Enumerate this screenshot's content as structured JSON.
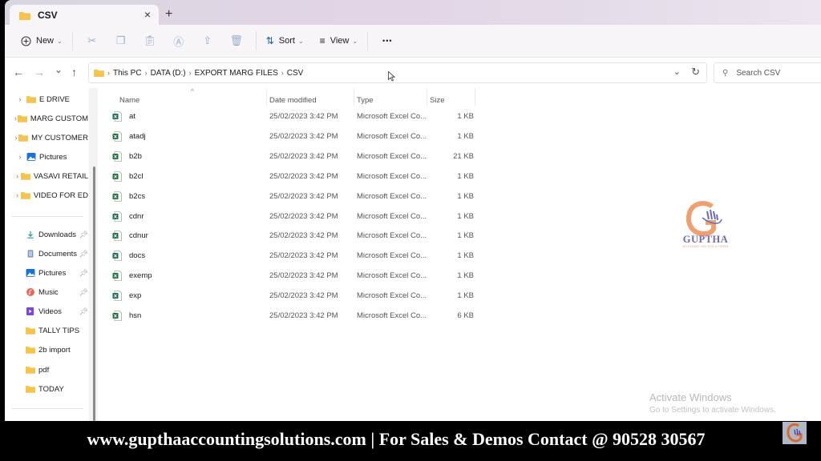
{
  "window": {
    "tab_label": "CSV",
    "tab_close_icon": "×",
    "new_tab_icon": "+"
  },
  "toolbar": {
    "new_label": "New",
    "sort_label": "Sort",
    "view_label": "View",
    "more_label": "•••",
    "icons": [
      "cut-icon",
      "copy-icon",
      "paste-icon",
      "rename-icon",
      "share-icon",
      "delete-icon"
    ]
  },
  "navigation": {
    "back": "←",
    "forward": "→",
    "recent": "⌄",
    "up": "↑",
    "breadcrumb": [
      "This PC",
      "DATA (D:)",
      "EXPORT MARG FILES",
      "CSV"
    ],
    "search_placeholder": "Search CSV"
  },
  "sidebar": {
    "tree_items": [
      {
        "label": "E DRIVE",
        "icon": "folder"
      },
      {
        "label": "MARG CUSTOM",
        "icon": "folder"
      },
      {
        "label": "MY CUSTOMER",
        "icon": "folder"
      },
      {
        "label": "Pictures",
        "icon": "pictures"
      },
      {
        "label": "VASAVI RETAIL",
        "icon": "folder"
      },
      {
        "label": "VIDEO FOR ED",
        "icon": "folder"
      }
    ],
    "quick_access": [
      {
        "label": "Downloads",
        "icon": "downloads",
        "pinned": true
      },
      {
        "label": "Documents",
        "icon": "documents",
        "pinned": true
      },
      {
        "label": "Pictures",
        "icon": "pictures",
        "pinned": true
      },
      {
        "label": "Music",
        "icon": "music",
        "pinned": true
      },
      {
        "label": "Videos",
        "icon": "videos",
        "pinned": true
      },
      {
        "label": "TALLY TIPS",
        "icon": "folder",
        "pinned": false
      },
      {
        "label": "2b import",
        "icon": "folder",
        "pinned": false
      },
      {
        "label": "pdf",
        "icon": "folder",
        "pinned": false
      },
      {
        "label": "TODAY",
        "icon": "folder",
        "pinned": false
      }
    ]
  },
  "file_list": {
    "columns": {
      "name": "Name",
      "date": "Date modified",
      "type": "Type",
      "size": "Size"
    },
    "files": [
      {
        "name": "at",
        "date": "25/02/2023 3:42 PM",
        "type": "Microsoft Excel Co...",
        "size": "1 KB"
      },
      {
        "name": "atadj",
        "date": "25/02/2023 3:42 PM",
        "type": "Microsoft Excel Co...",
        "size": "1 KB"
      },
      {
        "name": "b2b",
        "date": "25/02/2023 3:42 PM",
        "type": "Microsoft Excel Co...",
        "size": "21 KB"
      },
      {
        "name": "b2cl",
        "date": "25/02/2023 3:42 PM",
        "type": "Microsoft Excel Co...",
        "size": "1 KB"
      },
      {
        "name": "b2cs",
        "date": "25/02/2023 3:42 PM",
        "type": "Microsoft Excel Co...",
        "size": "1 KB"
      },
      {
        "name": "cdnr",
        "date": "25/02/2023 3:42 PM",
        "type": "Microsoft Excel Co...",
        "size": "1 KB"
      },
      {
        "name": "cdnur",
        "date": "25/02/2023 3:42 PM",
        "type": "Microsoft Excel Co...",
        "size": "1 KB"
      },
      {
        "name": "docs",
        "date": "25/02/2023 3:42 PM",
        "type": "Microsoft Excel Co...",
        "size": "1 KB"
      },
      {
        "name": "exemp",
        "date": "25/02/2023 3:42 PM",
        "type": "Microsoft Excel Co...",
        "size": "1 KB"
      },
      {
        "name": "exp",
        "date": "25/02/2023 3:42 PM",
        "type": "Microsoft Excel Co...",
        "size": "1 KB"
      },
      {
        "name": "hsn",
        "date": "25/02/2023 3:42 PM",
        "type": "Microsoft Excel Co...",
        "size": "6 KB"
      }
    ]
  },
  "watermark": {
    "logo_name": "GUPTHA",
    "logo_sub": "ACCOUNTING SOLUTIONS",
    "activate_title": "Activate Windows",
    "activate_sub": "Go to Settings to activate Windows."
  },
  "banner": {
    "text": "www.gupthaaccountingsolutions.com | For Sales & Demos Contact @ 90528 30567"
  },
  "colors": {
    "folder": "#f5c44e",
    "excel": "#1e7145",
    "logo_orange": "#f0a070",
    "logo_purple": "#6a6ab8"
  }
}
